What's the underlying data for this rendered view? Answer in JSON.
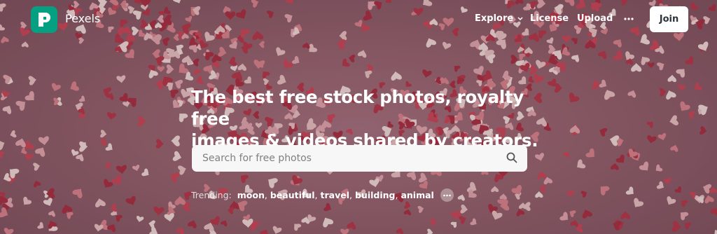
{
  "brand": {
    "name": "Pexels",
    "accent": "#05a081"
  },
  "nav": {
    "explore": "Explore",
    "license": "License",
    "upload": "Upload",
    "more_icon": "ellipsis-icon",
    "join": "Join"
  },
  "hero": {
    "headline_line1": "The best free stock photos, royalty free",
    "headline_line2": "images & videos shared by creators.",
    "search": {
      "placeholder": "Search for free photos",
      "value": "",
      "icon": "search-icon"
    },
    "trending": {
      "label": "Trending:",
      "items": [
        "moon",
        "beautiful",
        "travel",
        "building",
        "animal"
      ],
      "more_icon": "ellipsis-icon"
    },
    "background_color": "#93636f"
  }
}
